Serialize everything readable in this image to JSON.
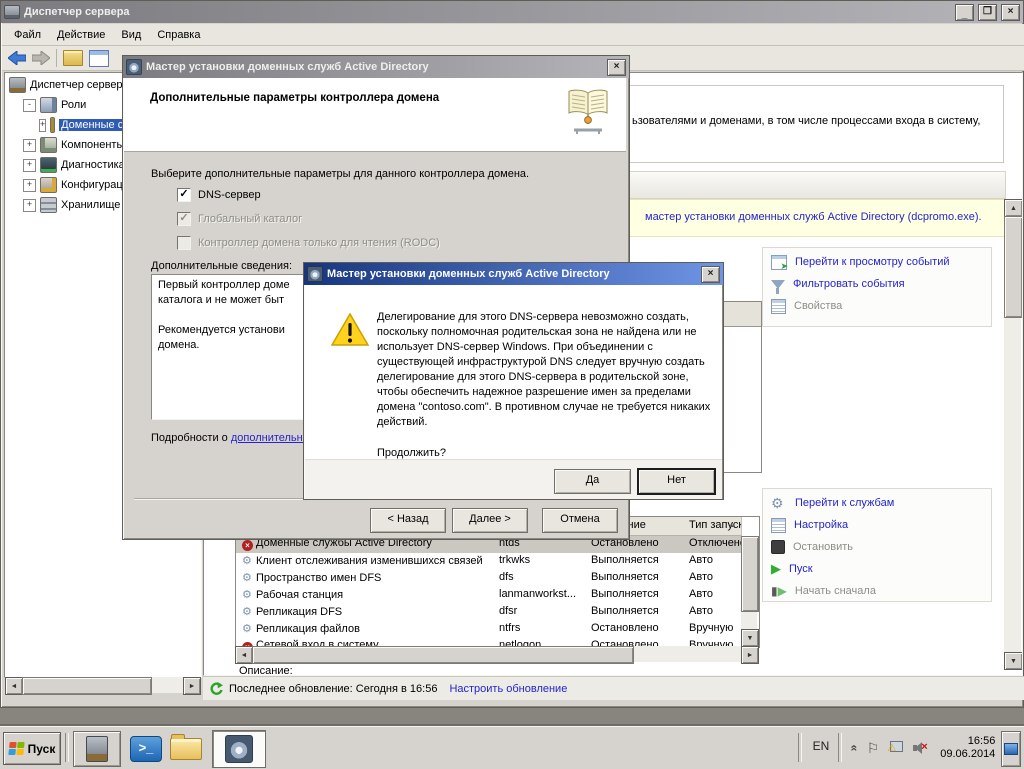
{
  "main_window": {
    "title": "Диспетчер сервера",
    "menu": [
      "Файл",
      "Действие",
      "Вид",
      "Справка"
    ],
    "tree": {
      "root": "Диспетчер сервера",
      "items": [
        {
          "label": "Роли",
          "state": "-"
        },
        {
          "label": "Доменные службы Active Directory",
          "state": "+"
        },
        {
          "label": "Компоненты",
          "state": "+"
        },
        {
          "label": "Диагностика",
          "state": "+"
        },
        {
          "label": "Конфигурация",
          "state": "+"
        },
        {
          "label": "Хранилище",
          "state": "+"
        }
      ]
    },
    "content": {
      "intro_fragment": "ьзователями и доменами, в том числе процессами входа в систему,",
      "banner_link_fragment": "мастер установки доменных служб Active Directory (dcpromo.exe).",
      "events_actions": [
        {
          "label": "Перейти к просмотру событий",
          "disabled": false
        },
        {
          "label": "Фильтровать события",
          "disabled": false
        },
        {
          "label": "Свойства",
          "disabled": true
        }
      ],
      "services_actions": [
        {
          "label": "Перейти к службам",
          "disabled": false
        },
        {
          "label": "Настройка",
          "disabled": false
        },
        {
          "label": "Остановить",
          "disabled": true
        },
        {
          "label": "Пуск",
          "disabled": false
        },
        {
          "label": "Начать сначала",
          "disabled": true
        }
      ],
      "services_table": {
        "headers": {
          "name": "",
          "service": "",
          "state": "Состояние",
          "startup": "Тип запуска"
        },
        "rows": [
          {
            "name": "Доменные службы Active Directory",
            "service": "ntds",
            "state": "Остановлено",
            "startup": "Отключено",
            "icon": "error",
            "selected": true
          },
          {
            "name": "Клиент отслеживания изменившихся связей",
            "service": "trkwks",
            "state": "Выполняется",
            "startup": "Авто",
            "icon": "gear"
          },
          {
            "name": "Пространство имен DFS",
            "service": "dfs",
            "state": "Выполняется",
            "startup": "Авто",
            "icon": "gear"
          },
          {
            "name": "Рабочая станция",
            "service": "lanmanworkst...",
            "state": "Выполняется",
            "startup": "Авто",
            "icon": "gear"
          },
          {
            "name": "Репликация DFS",
            "service": "dfsr",
            "state": "Выполняется",
            "startup": "Авто",
            "icon": "gear"
          },
          {
            "name": "Репликация файлов",
            "service": "ntfrs",
            "state": "Остановлено",
            "startup": "Вручную",
            "icon": "gear"
          },
          {
            "name": "Сетевой вход в систему",
            "service": "netlogon",
            "state": "Остановлено",
            "startup": "Вручную",
            "icon": "error"
          }
        ]
      },
      "description_label": "Описание:",
      "status": {
        "refresh_text": "Последнее обновление: Сегодня в 16:56",
        "refresh_link": "Настроить обновление"
      }
    }
  },
  "wizard": {
    "title": "Мастер установки доменных служб Active Directory",
    "heading": "Дополнительные параметры контроллера домена",
    "instruction": "Выберите дополнительные параметры для данного контроллера домена.",
    "checkboxes": [
      {
        "label": "DNS-сервер",
        "checked": true,
        "disabled": false
      },
      {
        "label": "Глобальный каталог",
        "checked": true,
        "disabled": true
      },
      {
        "label": "Контроллер домена только для чтения (RODC)",
        "checked": false,
        "disabled": true
      }
    ],
    "info_label": "Дополнительные сведения:",
    "info_lines": "Первый контроллер доме\nкаталога и не может быт\n\nРекомендуется установи\nдомена.",
    "details_prefix": "Подробности о ",
    "details_link": "дополнительных параметрах",
    "buttons": {
      "back": "< Назад",
      "next": "Далее >",
      "cancel": "Отмена"
    }
  },
  "alert": {
    "title": "Мастер установки доменных служб Active Directory",
    "message": "Делегирование для этого DNS-сервера невозможно создать, поскольку полномочная родительская зона не найдена или не использует DNS-сервер Windows. При объединении с существующей инфраструктурой DNS следует вручную создать делегирование для этого DNS-сервера в родительской зоне, чтобы обеспечить надежное разрешение имен за пределами домена \"contoso.com\". В противном случае не требуется никаких действий.",
    "question": "Продолжить?",
    "buttons": {
      "yes": "Да",
      "no": "Нет"
    }
  },
  "taskbar": {
    "start_label": "Пуск",
    "language": "EN",
    "clock": {
      "time": "16:56",
      "date": "09.06.2014"
    }
  }
}
